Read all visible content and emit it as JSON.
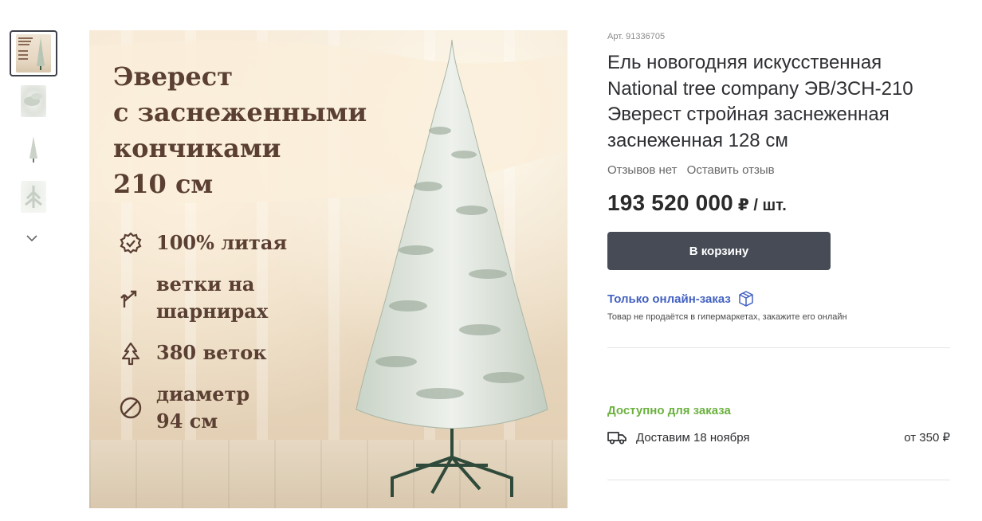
{
  "gallery": {
    "thumbnails": [
      {
        "name": "thumbnail-1",
        "active": true
      },
      {
        "name": "thumbnail-2",
        "active": false
      },
      {
        "name": "thumbnail-3",
        "active": false
      },
      {
        "name": "thumbnail-4",
        "active": false
      }
    ],
    "more_icon": "chevron-down-icon"
  },
  "hero": {
    "title": "Эверест\nс заснеженными\nкончиками\n210 см",
    "features": [
      {
        "icon": "badge-check-icon",
        "text": "100% литая"
      },
      {
        "icon": "hinge-arrow-icon",
        "text": "ветки на\nшарнирах"
      },
      {
        "icon": "tree-icon",
        "text": "380 веток"
      },
      {
        "icon": "diameter-icon",
        "text": "диаметр\n94 см"
      }
    ]
  },
  "product": {
    "article": "Арт. 91336705",
    "title": "Ель новогодняя искусственная National tree company ЭВ/ЗСН-210 Эверест стройная заснеженная заснеженная 128 см",
    "reviews_count_label": "Отзывов нет",
    "leave_review_label": "Оставить отзыв",
    "price": "193 520 000",
    "price_unit": "₽ / шт.",
    "cart_button": "В корзину",
    "online_only_label": "Только онлайн-заказ",
    "online_only_note": "Товар не продаётся в гипермаркетах, закажите его онлайн",
    "availability": "Доступно для заказа",
    "delivery_text": "Доставим 18 ноября",
    "delivery_price": "от 350 ₽"
  },
  "colors": {
    "accent_dark": "#474b56",
    "link_blue": "#4361c2",
    "available_green": "#6bb13e",
    "hero_text_brown": "#5a3f32"
  }
}
